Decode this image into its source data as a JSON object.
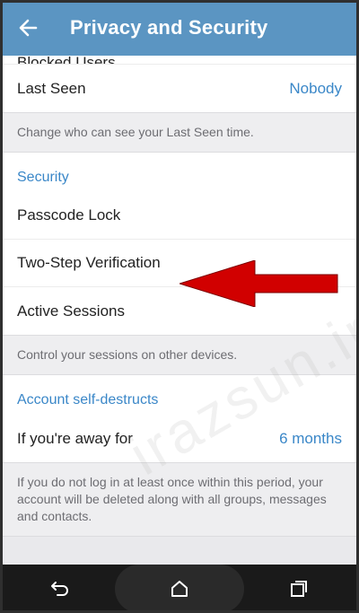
{
  "header": {
    "title": "Privacy and Security",
    "back_icon": "arrow-left-icon"
  },
  "privacy": {
    "blocked_users": "Blocked Users",
    "last_seen_label": "Last Seen",
    "last_seen_value": "Nobody",
    "last_seen_info": "Change who can see your Last Seen time."
  },
  "security": {
    "heading": "Security",
    "passcode_lock": "Passcode Lock",
    "two_step": "Two-Step Verification",
    "active_sessions": "Active Sessions",
    "sessions_info": "Control your sessions on other devices."
  },
  "account": {
    "heading": "Account self-destructs",
    "away_label": "If you're away for",
    "away_value": "6 months",
    "info": "If you do not log in at least once within this period, your account will be deleted along with all groups, messages and contacts."
  },
  "navbar": {
    "back_icon": "nav-back-icon",
    "home_icon": "home-icon",
    "recents_icon": "recents-icon"
  },
  "overlay": {
    "watermark": "irazsun.ir",
    "arrow_color": "#d10000"
  },
  "colors": {
    "header_bg": "#5b95c2",
    "accent": "#3a87c8"
  }
}
